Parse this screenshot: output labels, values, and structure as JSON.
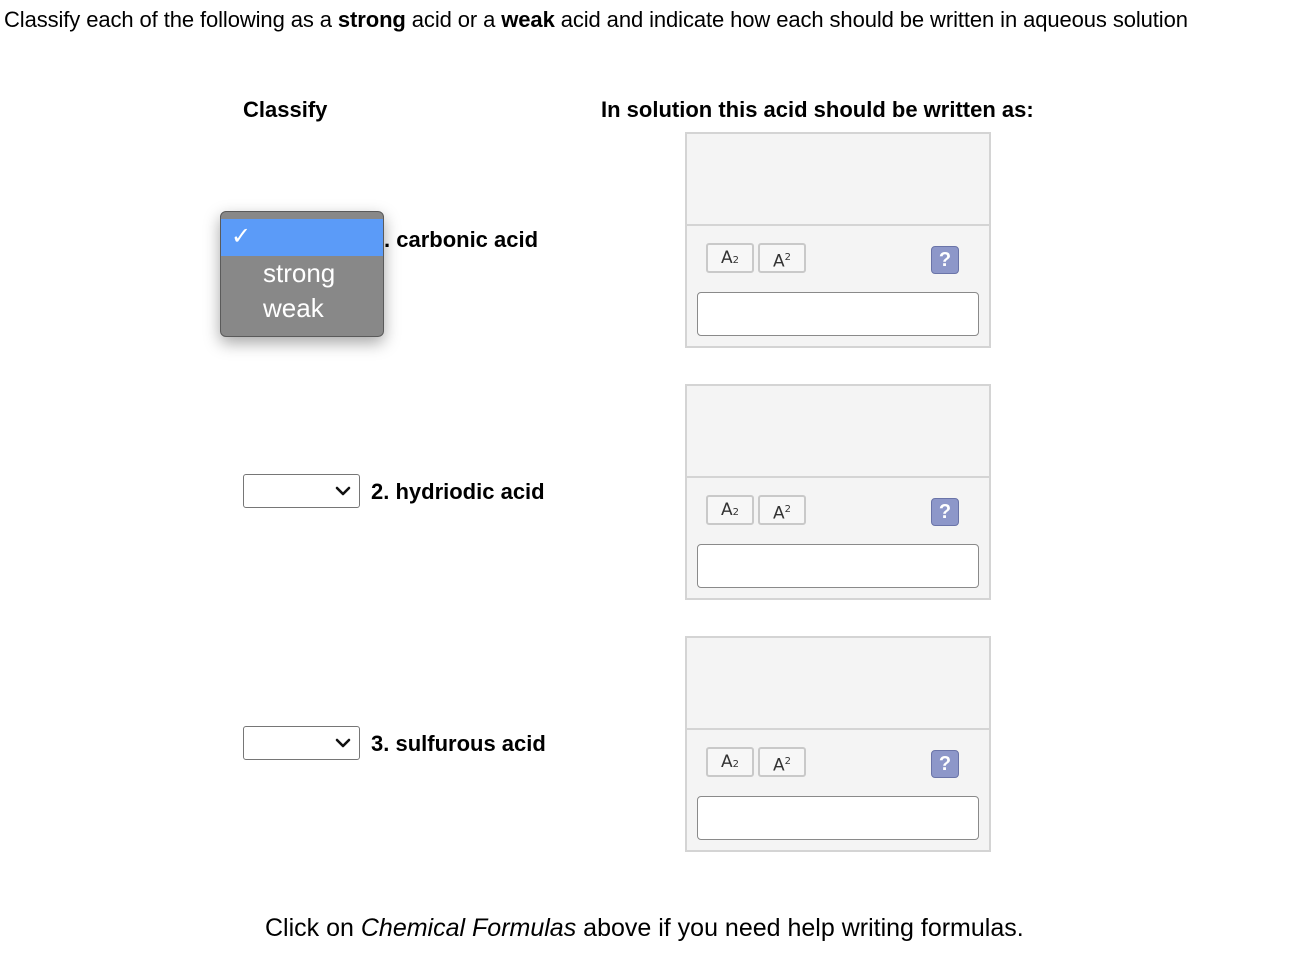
{
  "instruction": {
    "part1": "Classify each of the following as a ",
    "strong": "strong",
    "part2": " acid or a ",
    "weak": "weak",
    "part3": " acid and indicate how each should be written in aqueous solution"
  },
  "headers": {
    "classify": "Classify",
    "solution": "In solution this acid should be written as:"
  },
  "dropdown": {
    "check": "✓",
    "options": [
      "strong",
      "weak"
    ]
  },
  "questions": [
    {
      "label": ". carbonic acid",
      "selected": ""
    },
    {
      "label": "2. hydriodic acid",
      "selected": ""
    },
    {
      "label": "3. sulfurous acid",
      "selected": ""
    }
  ],
  "answer_widget": {
    "subscript_main": "A",
    "subscript_mark": "2",
    "superscript_main": "A",
    "superscript_mark": "2",
    "help": "?"
  },
  "footer": {
    "part1": "Click on ",
    "link": "Chemical Formulas",
    "part2": " above if you need help writing formulas."
  }
}
